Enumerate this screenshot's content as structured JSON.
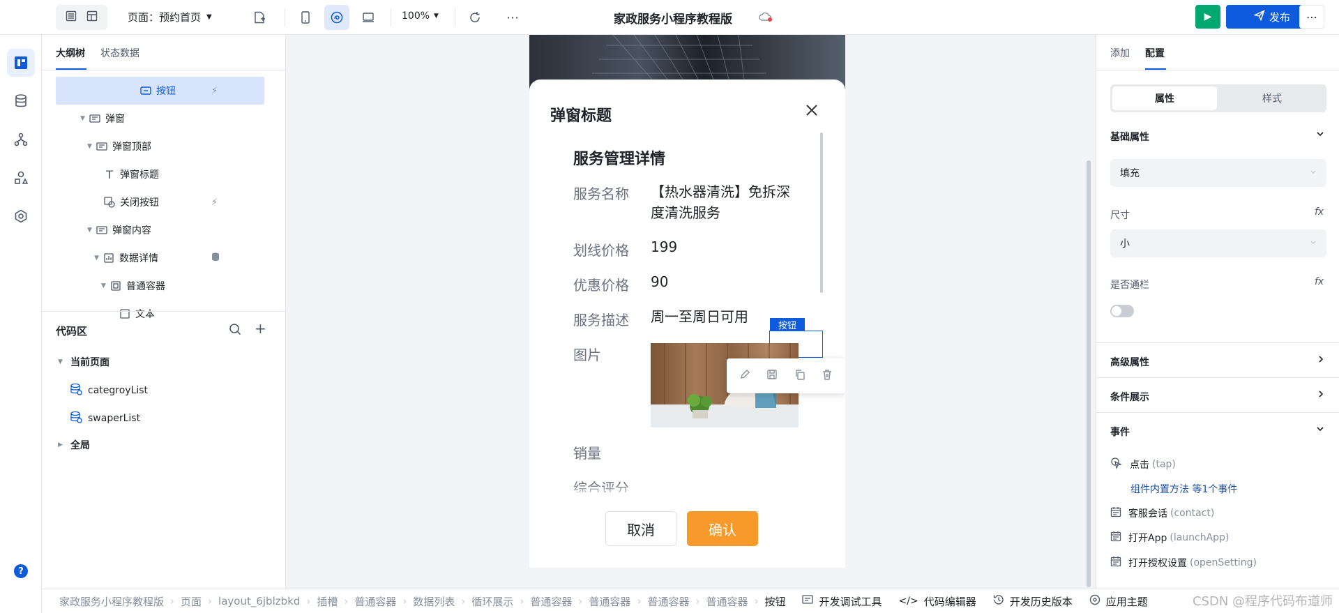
{
  "app": {
    "page_selector": "页面：预约首页",
    "project_title": "家政服务小程序教程版",
    "zoom": "100%",
    "run_label": "▶",
    "publish_label": "发布",
    "more_label": "⋯"
  },
  "left": {
    "tabs": [
      "大纲树",
      "状态数据"
    ],
    "tree": [
      {
        "label": "按钮",
        "icon": "button-icon"
      },
      {
        "label": "弹窗",
        "icon": "popup-icon"
      },
      {
        "label": "弹窗顶部",
        "icon": "container-icon"
      },
      {
        "label": "弹窗标题",
        "icon": "text-icon"
      },
      {
        "label": "关闭按钮",
        "icon": "close-button-icon"
      },
      {
        "label": "弹窗内容",
        "icon": "container-icon"
      },
      {
        "label": "数据详情",
        "icon": "chart-icon"
      },
      {
        "label": "普通容器",
        "icon": "box-icon"
      },
      {
        "label": "文本",
        "icon": "text-icon"
      }
    ],
    "code_title": "代码区",
    "current_page": "当前页面",
    "datasets": [
      "categroyList",
      "swaperList"
    ],
    "global": "全局"
  },
  "dialog": {
    "title": "弹窗标题",
    "heading": "服务管理详情",
    "rows": [
      {
        "label": "服务名称",
        "value": "【热水器清洗】免拆深度清洗服务"
      },
      {
        "label": "划线价格",
        "value": "199"
      },
      {
        "label": "优惠价格",
        "value": "90"
      },
      {
        "label": "服务描述",
        "value": "周一至周日可用"
      },
      {
        "label": "图片",
        "value": ""
      },
      {
        "label": "销量",
        "value": ""
      },
      {
        "label": "综合评分",
        "value": ""
      }
    ],
    "selected_tag": "按钮",
    "cancel": "取消",
    "confirm": "确认"
  },
  "right": {
    "tabs": [
      "添加",
      "配置"
    ],
    "seg": [
      "属性",
      "样式"
    ],
    "basic": "基础属性",
    "fill_value": "填充",
    "size_label": "尺寸",
    "size_value": "小",
    "block_label": "是否通栏",
    "fx": "fx",
    "advanced": "高级属性",
    "condition": "条件展示",
    "events": "事件",
    "event_list": [
      {
        "name": "点击",
        "code": "(tap)"
      },
      {
        "name": "组件内置方法 等1个事件",
        "code": ""
      },
      {
        "name": "客服会话",
        "code": "(contact)"
      },
      {
        "name": "打开App",
        "code": "(launchApp)"
      },
      {
        "name": "打开授权设置",
        "code": "(openSetting)"
      }
    ]
  },
  "breadcrumb": [
    "家政服务小程序教程版",
    "页面",
    "layout_6jblzbkd",
    "插槽",
    "普通容器",
    "数据列表",
    "循环展示",
    "普通容器",
    "普通容器",
    "普通容器",
    "普通容器",
    "按钮"
  ],
  "bottom_tools": [
    "开发调试工具",
    "代码编辑器",
    "开发历史版本",
    "应用主题"
  ],
  "watermark": "CSDN @程序代码布道师",
  "colors": {
    "accent": "#0d5bdc",
    "green": "#00a870",
    "orange": "#f79a2b"
  }
}
